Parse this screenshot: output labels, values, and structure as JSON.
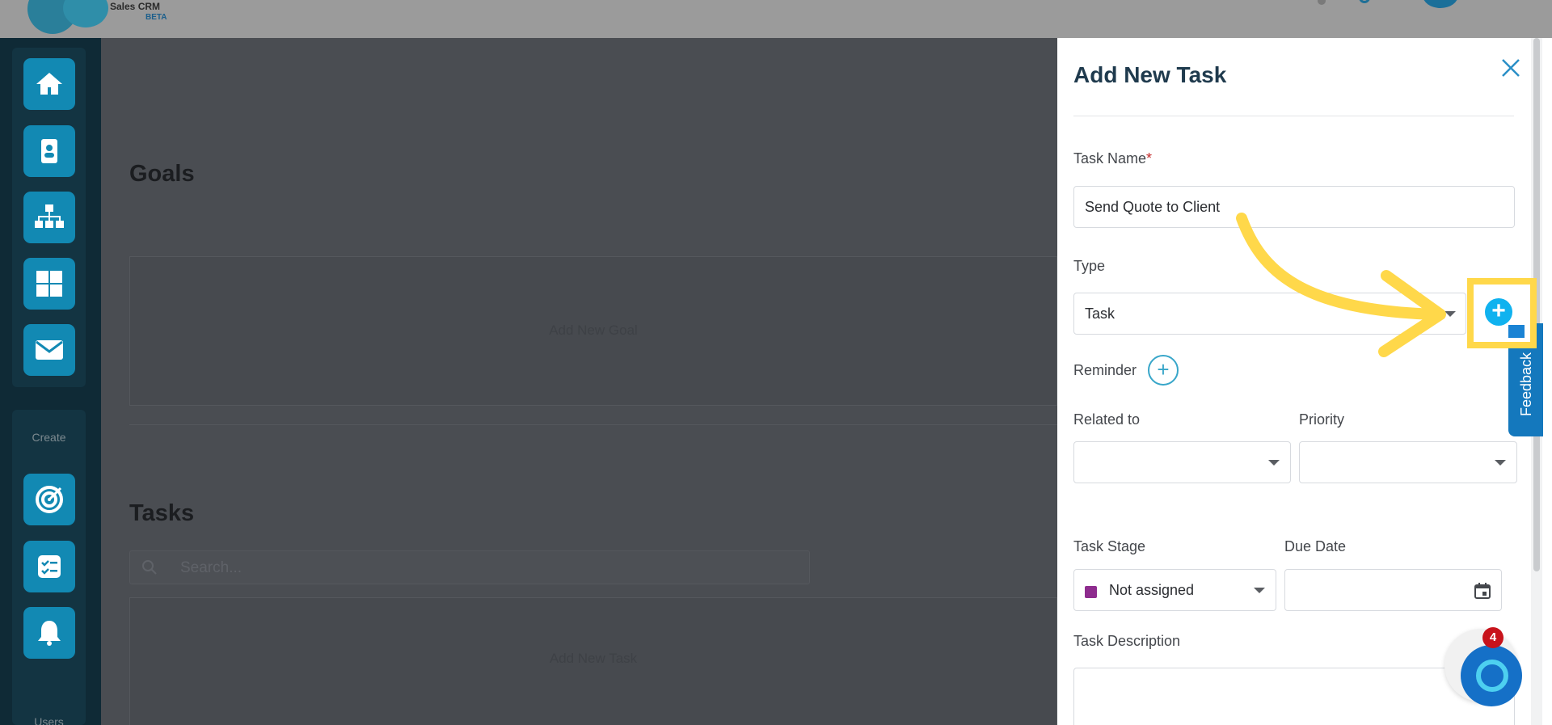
{
  "header": {
    "logo_line1": "Sales CRM",
    "logo_beta": "BETA"
  },
  "sidebar": {
    "items": [
      {
        "icon": "home-icon"
      },
      {
        "icon": "contact-card-icon"
      },
      {
        "icon": "org-chart-icon"
      },
      {
        "icon": "dashboard-grid-icon"
      },
      {
        "icon": "mail-icon"
      }
    ],
    "create_label": "Create",
    "create_items": [
      {
        "icon": "target-icon"
      },
      {
        "icon": "checklist-icon"
      },
      {
        "icon": "bell-icon"
      }
    ],
    "users_label": "Users"
  },
  "main": {
    "goals_title": "Goals",
    "goals_placeholder": "Add New Goal",
    "tasks_title": "Tasks",
    "search_placeholder": "Search...",
    "tasks_placeholder": "Add New Task"
  },
  "panel": {
    "title": "Add New Task",
    "task_name_label": "Task Name",
    "required_mark": "*",
    "task_name_value": "Send Quote to Client",
    "type_label": "Type",
    "type_value": "Task",
    "reminder_label": "Reminder",
    "related_label": "Related to",
    "priority_label": "Priority",
    "stage_label": "Task Stage",
    "stage_value": "Not assigned",
    "due_label": "Due Date",
    "description_label": "Task Description"
  },
  "feedback_label": "Feedback",
  "chat_badge": "4",
  "colors": {
    "accent": "#1289b3",
    "highlight": "#ffd84a",
    "stage_swatch": "#8e2c8e"
  }
}
